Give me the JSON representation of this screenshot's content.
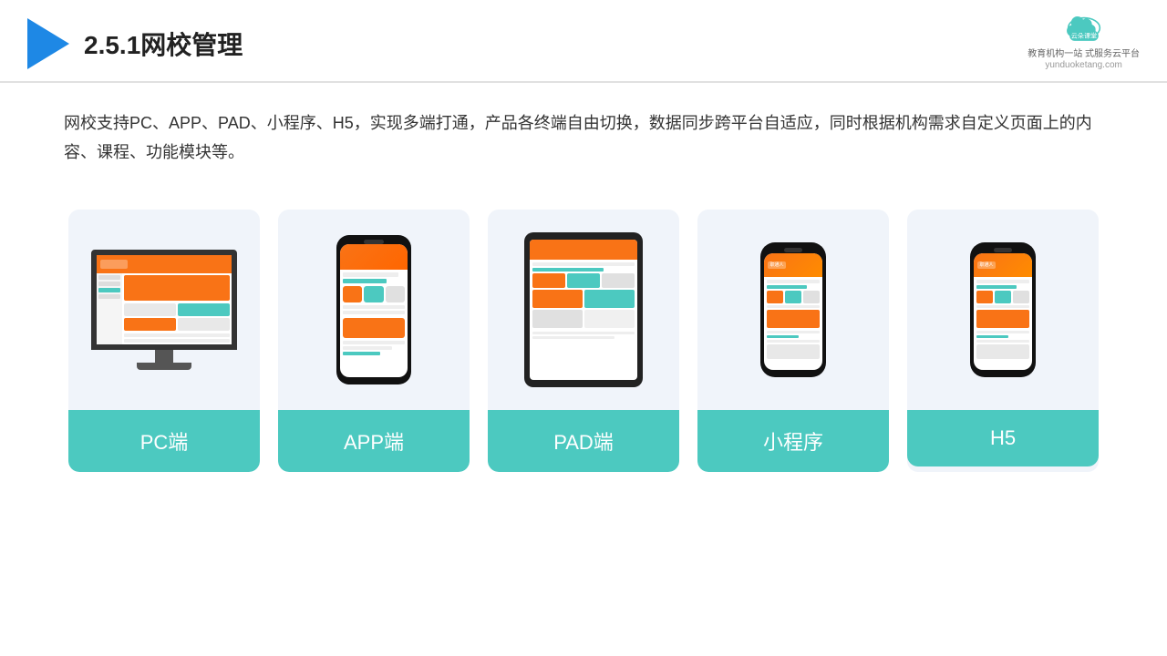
{
  "header": {
    "title": "2.5.1网校管理",
    "brand": {
      "name": "云朵课堂",
      "url": "yunduoketang.com",
      "tagline": "教育机构一站\n式服务云平台"
    }
  },
  "description": "网校支持PC、APP、PAD、小程序、H5，实现多端打通，产品各终端自由切换，数据同步跨平台自适应，同时根据机构需求自定义页面上的内容、课程、功能模块等。",
  "cards": [
    {
      "id": "pc",
      "label": "PC端"
    },
    {
      "id": "app",
      "label": "APP端"
    },
    {
      "id": "pad",
      "label": "PAD端"
    },
    {
      "id": "miniprogram",
      "label": "小程序"
    },
    {
      "id": "h5",
      "label": "H5"
    }
  ],
  "colors": {
    "teal": "#4cc9c0",
    "accent": "#f97316",
    "border": "#e0e0e0",
    "bg_card": "#f0f4fa",
    "text_main": "#222",
    "brand_blue": "#1e88e5"
  }
}
